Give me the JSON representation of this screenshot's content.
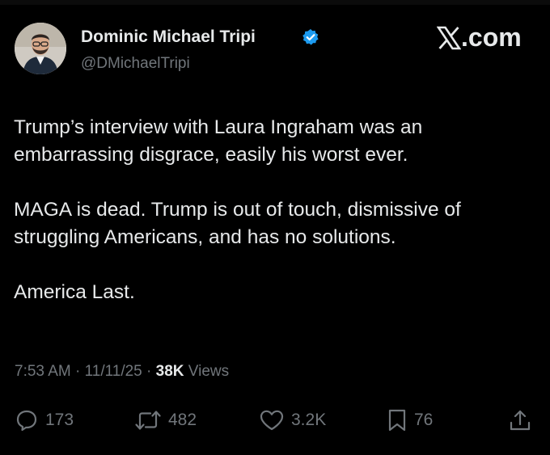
{
  "author": {
    "display_name": "Dominic Michael Tripi",
    "handle": "@DMichaelTripi",
    "verified": true,
    "avatar_icon": "profile-photo"
  },
  "brand": {
    "icon": "x-logo-icon",
    "text": ".com"
  },
  "tweet": {
    "paragraphs": [
      "Trump’s interview with Laura Ingraham was an\nembarrassing disgrace, easily his worst ever.",
      "MAGA is dead. Trump is out of touch, dismissive of\nstruggling Americans, and has no solutions.",
      "America Last."
    ]
  },
  "meta": {
    "time": "7:53 AM",
    "separator": " · ",
    "date": "11/11/25",
    "views_count": "38K",
    "views_label": " Views"
  },
  "actions": {
    "replies": "173",
    "reposts": "482",
    "likes": "3.2K",
    "bookmarks": "76"
  },
  "colors": {
    "background": "#000000",
    "text": "#e7e9ea",
    "muted": "#71767b",
    "verified": "#1d9bf0"
  }
}
